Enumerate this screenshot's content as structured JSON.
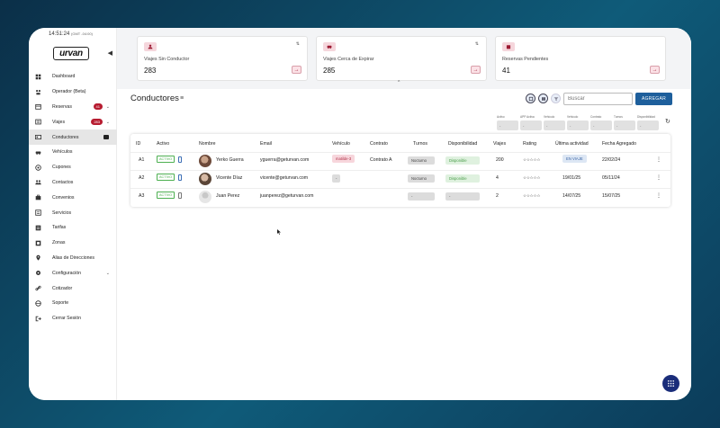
{
  "clock": {
    "time": "14:51:24",
    "tz": "(GMT -04:00)"
  },
  "brand": {
    "logo": "urvan",
    "accent": "#b71c30",
    "primary": "#1e5f9c"
  },
  "sidebar": {
    "items": [
      {
        "label": "Dashboard",
        "icon": "dashboard-icon"
      },
      {
        "label": "Operador (Beta)",
        "icon": "operator-icon"
      },
      {
        "label": "Reservas",
        "icon": "reservations-icon",
        "badge": "41",
        "chevron": true
      },
      {
        "label": "Viajes",
        "icon": "trips-icon",
        "badge": "283",
        "chevron": true
      },
      {
        "label": "Conductores",
        "icon": "drivers-icon",
        "active": true
      },
      {
        "label": "Vehículos",
        "icon": "car-icon"
      },
      {
        "label": "Cupones",
        "icon": "coupon-icon"
      },
      {
        "label": "Contactos",
        "icon": "contacts-icon"
      },
      {
        "label": "Convenios",
        "icon": "agreements-icon"
      },
      {
        "label": "Servicios",
        "icon": "services-icon"
      },
      {
        "label": "Tarifas",
        "icon": "rates-icon"
      },
      {
        "label": "Zonas",
        "icon": "zones-icon"
      },
      {
        "label": "Alias de Direcciones",
        "icon": "location-icon"
      },
      {
        "label": "Configuración",
        "icon": "settings-icon",
        "chevron": true
      },
      {
        "label": "Cotizador",
        "icon": "link-icon"
      },
      {
        "label": "Soporte",
        "icon": "support-icon"
      },
      {
        "label": "Cerrar Sesión",
        "icon": "logout-icon"
      }
    ]
  },
  "cards": [
    {
      "title": "Viajes Sin Conductor",
      "value": "283"
    },
    {
      "title": "Viajes Cerca de Expirar",
      "value": "285"
    },
    {
      "title": "Reservas Pendientes",
      "value": "41"
    }
  ],
  "page": {
    "title": "Conductores",
    "search_placeholder": "Buscar",
    "add_label": "AGREGAR"
  },
  "filters": [
    {
      "label": "Activo",
      "value": "-"
    },
    {
      "label": "APP Activa",
      "value": "-"
    },
    {
      "label": "Vehículo",
      "value": "-"
    },
    {
      "label": "Vehículo",
      "value": "-"
    },
    {
      "label": "Contrato",
      "value": "-"
    },
    {
      "label": "Turnos",
      "value": "-"
    },
    {
      "label": "Disponibilidad",
      "value": "-"
    }
  ],
  "table": {
    "headers": [
      "ID",
      "Activo",
      "Nombre",
      "Email",
      "Vehículo",
      "Contrato",
      "Turnos",
      "Disponibilidad",
      "Viajes",
      "Rating",
      "Última actividad",
      "Fecha Agregado"
    ],
    "rows": [
      {
        "id": "A1",
        "activo": "ACTIVO",
        "nombre": "Yerko Guerra",
        "email": "yguerra@geturvan.com",
        "vehiculo": "matilde-3",
        "contrato": "Contrato A",
        "turnos": "Nocturno",
        "disponibilidad": "Disponible",
        "viajes": "200",
        "rating": "☆☆☆☆☆",
        "ultima": "EN VIAJE",
        "fecha": "22/02/24"
      },
      {
        "id": "A2",
        "activo": "ACTIVO",
        "nombre": "Vicente Díaz",
        "email": "vicente@geturvan.com",
        "vehiculo": "-",
        "contrato": "",
        "turnos": "Nocturno",
        "disponibilidad": "Disponible",
        "viajes": "4",
        "rating": "☆☆☆☆☆",
        "ultima": "19/01/25",
        "fecha": "05/11/24"
      },
      {
        "id": "A3",
        "activo": "ACTIVO",
        "nombre": "Juan Perez",
        "email": "juanperez@geturvan.com",
        "vehiculo": "",
        "contrato": "",
        "turnos": "-",
        "disponibilidad": "-",
        "viajes": "2",
        "rating": "☆☆☆☆☆",
        "ultima": "14/07/25",
        "fecha": "15/07/25"
      }
    ]
  }
}
